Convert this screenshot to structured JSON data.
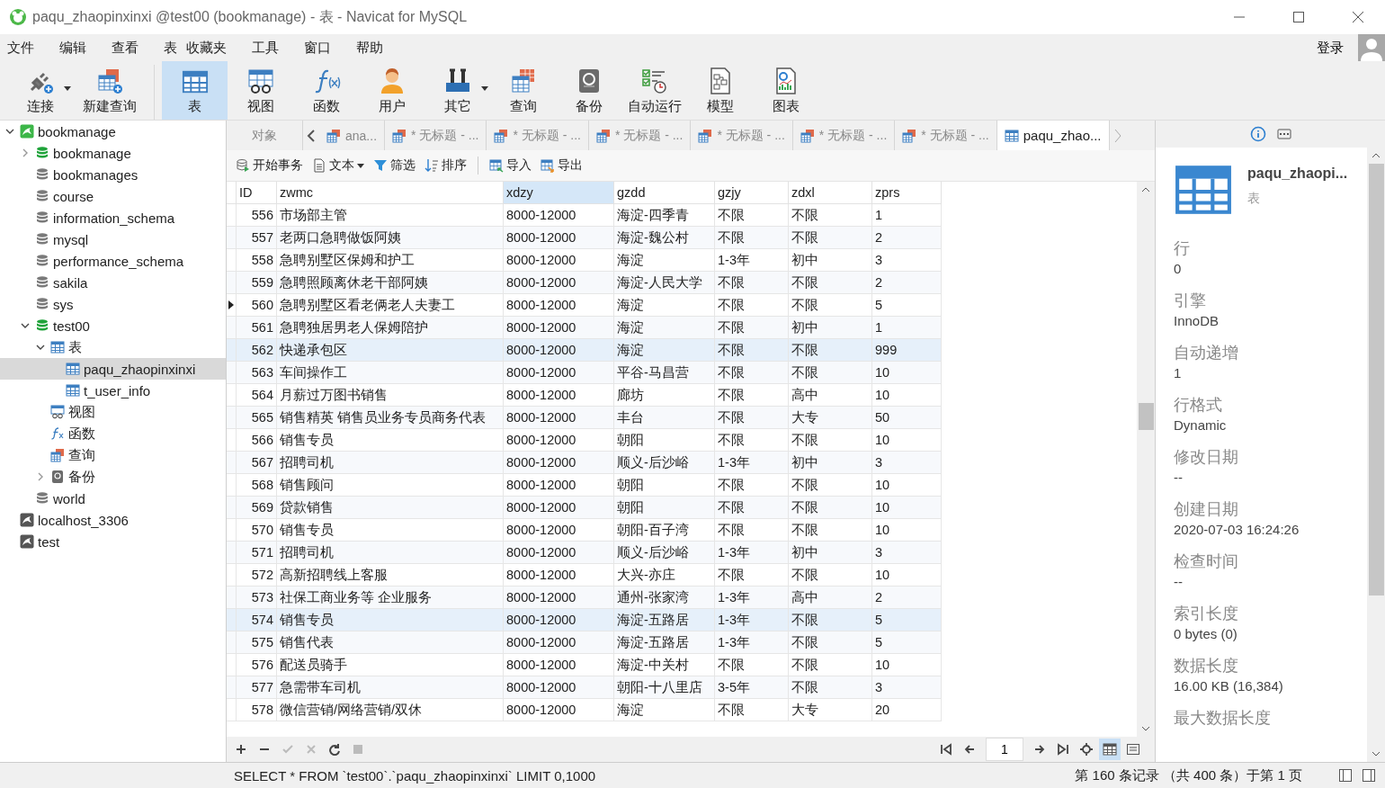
{
  "window": {
    "title": "paqu_zhaopinxinxi @test00 (bookmanage) - 表 - Navicat for MySQL"
  },
  "menu": [
    "文件",
    "编辑",
    "查看",
    "表",
    "收藏夹",
    "工具",
    "窗口",
    "帮助"
  ],
  "login": "登录",
  "toolbar": [
    {
      "label": "连接",
      "kind": "connect",
      "selected": false,
      "dropdown": true
    },
    {
      "label": "新建查询",
      "kind": "new-query",
      "selected": false,
      "dropdown": false
    },
    {
      "label": "表",
      "kind": "table",
      "selected": true,
      "dropdown": false
    },
    {
      "label": "视图",
      "kind": "view",
      "selected": false,
      "dropdown": false
    },
    {
      "label": "函数",
      "kind": "function",
      "selected": false,
      "dropdown": false
    },
    {
      "label": "用户",
      "kind": "user",
      "selected": false,
      "dropdown": false
    },
    {
      "label": "其它",
      "kind": "tools",
      "selected": false,
      "dropdown": true
    },
    {
      "label": "查询",
      "kind": "query",
      "selected": false,
      "dropdown": false
    },
    {
      "label": "备份",
      "kind": "backup",
      "selected": false,
      "dropdown": false
    },
    {
      "label": "自动运行",
      "kind": "schedule",
      "selected": false,
      "dropdown": false
    },
    {
      "label": "模型",
      "kind": "model",
      "selected": false,
      "dropdown": false
    },
    {
      "label": "图表",
      "kind": "chart",
      "selected": false,
      "dropdown": false
    }
  ],
  "tree": [
    {
      "label": "bookmanage",
      "kind": "connection",
      "open": true,
      "expanded": true,
      "selected": false,
      "children": [
        {
          "label": "bookmanage",
          "kind": "database",
          "open": true,
          "expanded": false,
          "selected": false
        },
        {
          "label": "bookmanages",
          "kind": "database",
          "open": false,
          "selected": false
        },
        {
          "label": "course",
          "kind": "database",
          "open": false,
          "selected": false
        },
        {
          "label": "information_schema",
          "kind": "database",
          "open": false,
          "selected": false
        },
        {
          "label": "mysql",
          "kind": "database",
          "open": false,
          "selected": false
        },
        {
          "label": "performance_schema",
          "kind": "database",
          "open": false,
          "selected": false
        },
        {
          "label": "sakila",
          "kind": "database",
          "open": false,
          "selected": false
        },
        {
          "label": "sys",
          "kind": "database",
          "open": false,
          "selected": false
        },
        {
          "label": "test00",
          "kind": "database",
          "open": true,
          "expanded": true,
          "selected": false,
          "children": [
            {
              "label": "表",
              "kind": "tables",
              "expanded": true,
              "selected": false,
              "children": [
                {
                  "label": "paqu_zhaopinxinxi",
                  "kind": "table",
                  "selected": true
                },
                {
                  "label": "t_user_info",
                  "kind": "table",
                  "selected": false
                }
              ]
            },
            {
              "label": "视图",
              "kind": "views",
              "selected": false
            },
            {
              "label": "函数",
              "kind": "functions",
              "selected": false
            },
            {
              "label": "查询",
              "kind": "queries",
              "selected": false
            },
            {
              "label": "备份",
              "kind": "backups",
              "expanded": false,
              "selected": false
            }
          ]
        },
        {
          "label": "world",
          "kind": "database",
          "open": false,
          "selected": false
        }
      ]
    },
    {
      "label": "localhost_3306",
      "kind": "connection",
      "open": false,
      "selected": false
    },
    {
      "label": "test",
      "kind": "connection",
      "open": false,
      "selected": false
    }
  ],
  "tabs": [
    {
      "label": "对象",
      "kind": "objects",
      "selected": false
    },
    {
      "label": "ana...",
      "kind": "query",
      "selected": false
    },
    {
      "label": "* 无标题 - ...",
      "kind": "query",
      "selected": false
    },
    {
      "label": "* 无标题 - ...",
      "kind": "query",
      "selected": false
    },
    {
      "label": "* 无标题 - ...",
      "kind": "query",
      "selected": false
    },
    {
      "label": "* 无标题 - ...",
      "kind": "query",
      "selected": false
    },
    {
      "label": "* 无标题 - ...",
      "kind": "query",
      "selected": false
    },
    {
      "label": "* 无标题 - ...",
      "kind": "query",
      "selected": false
    },
    {
      "label": "paqu_zhao...",
      "kind": "table",
      "selected": true
    }
  ],
  "actions": [
    {
      "label": "开始事务",
      "kind": "transaction",
      "dropdown": false
    },
    {
      "label": "文本",
      "kind": "text",
      "dropdown": true
    },
    {
      "label": "筛选",
      "kind": "filter",
      "dropdown": false
    },
    {
      "label": "排序",
      "kind": "sort",
      "dropdown": false
    },
    {
      "label": "导入",
      "kind": "import",
      "dropdown": false
    },
    {
      "label": "导出",
      "kind": "export",
      "dropdown": false
    }
  ],
  "table": {
    "columns": [
      {
        "label": "ID",
        "selected": false
      },
      {
        "label": "zwmc",
        "selected": false
      },
      {
        "label": "xdzy",
        "selected": true
      },
      {
        "label": "gzdd",
        "selected": false
      },
      {
        "label": "gzjy",
        "selected": false
      },
      {
        "label": "zdxl",
        "selected": false
      },
      {
        "label": "zprs",
        "selected": false
      }
    ],
    "rows": [
      {
        "cells": [
          "556",
          "市场部主管",
          "8000-12000",
          "海淀-四季青",
          "不限",
          "不限",
          "1"
        ],
        "current": false,
        "highlighted": false
      },
      {
        "cells": [
          "557",
          "老两口急聘做饭阿姨",
          "8000-12000",
          "海淀-魏公村",
          "不限",
          "不限",
          "2"
        ],
        "current": false,
        "highlighted": false
      },
      {
        "cells": [
          "558",
          "急聘别墅区保姆和护工",
          "8000-12000",
          "海淀",
          "1-3年",
          "初中",
          "3"
        ],
        "current": false,
        "highlighted": false
      },
      {
        "cells": [
          "559",
          "急聘照顾离休老干部阿姨",
          "8000-12000",
          "海淀-人民大学",
          "不限",
          "不限",
          "2"
        ],
        "current": false,
        "highlighted": false
      },
      {
        "cells": [
          "560",
          "急聘别墅区看老俩老人夫妻工",
          "8000-12000",
          "海淀",
          "不限",
          "不限",
          "5"
        ],
        "current": true,
        "highlighted": false
      },
      {
        "cells": [
          "561",
          "急聘独居男老人保姆陪护",
          "8000-12000",
          "海淀",
          "不限",
          "初中",
          "1"
        ],
        "current": false,
        "highlighted": false
      },
      {
        "cells": [
          "562",
          "快递承包区",
          "8000-12000",
          "海淀",
          "不限",
          "不限",
          "999"
        ],
        "current": false,
        "highlighted": true
      },
      {
        "cells": [
          "563",
          "车间操作工",
          "8000-12000",
          "平谷-马昌营",
          "不限",
          "不限",
          "10"
        ],
        "current": false,
        "highlighted": false
      },
      {
        "cells": [
          "564",
          "月薪过万图书销售",
          "8000-12000",
          "廊坊",
          "不限",
          "高中",
          "10"
        ],
        "current": false,
        "highlighted": false
      },
      {
        "cells": [
          "565",
          "销售精英 销售员业务专员商务代表",
          "8000-12000",
          "丰台",
          "不限",
          "大专",
          "50"
        ],
        "current": false,
        "highlighted": false
      },
      {
        "cells": [
          "566",
          "销售专员",
          "8000-12000",
          "朝阳",
          "不限",
          "不限",
          "10"
        ],
        "current": false,
        "highlighted": false
      },
      {
        "cells": [
          "567",
          "招聘司机",
          "8000-12000",
          "顺义-后沙峪",
          "1-3年",
          "初中",
          "3"
        ],
        "current": false,
        "highlighted": false
      },
      {
        "cells": [
          "568",
          "销售顾问",
          "8000-12000",
          "朝阳",
          "不限",
          "不限",
          "10"
        ],
        "current": false,
        "highlighted": false
      },
      {
        "cells": [
          "569",
          "贷款销售",
          "8000-12000",
          "朝阳",
          "不限",
          "不限",
          "10"
        ],
        "current": false,
        "highlighted": false
      },
      {
        "cells": [
          "570",
          "销售专员",
          "8000-12000",
          "朝阳-百子湾",
          "不限",
          "不限",
          "10"
        ],
        "current": false,
        "highlighted": false
      },
      {
        "cells": [
          "571",
          "招聘司机",
          "8000-12000",
          "顺义-后沙峪",
          "1-3年",
          "初中",
          "3"
        ],
        "current": false,
        "highlighted": false
      },
      {
        "cells": [
          "572",
          "高新招聘线上客服",
          "8000-12000",
          "大兴-亦庄",
          "不限",
          "不限",
          "10"
        ],
        "current": false,
        "highlighted": false
      },
      {
        "cells": [
          "573",
          "社保工商业务等 企业服务",
          "8000-12000",
          "通州-张家湾",
          "1-3年",
          "高中",
          "2"
        ],
        "current": false,
        "highlighted": false
      },
      {
        "cells": [
          "574",
          "销售专员",
          "8000-12000",
          "海淀-五路居",
          "1-3年",
          "不限",
          "5"
        ],
        "current": false,
        "highlighted": true
      },
      {
        "cells": [
          "575",
          "销售代表",
          "8000-12000",
          "海淀-五路居",
          "1-3年",
          "不限",
          "5"
        ],
        "current": false,
        "highlighted": false
      },
      {
        "cells": [
          "576",
          "配送员骑手",
          "8000-12000",
          "海淀-中关村",
          "不限",
          "不限",
          "10"
        ],
        "current": false,
        "highlighted": false
      },
      {
        "cells": [
          "577",
          "急需带车司机",
          "8000-12000",
          "朝阳-十八里店",
          "3-5年",
          "不限",
          "3"
        ],
        "current": false,
        "highlighted": false
      },
      {
        "cells": [
          "578",
          "微信营销/网络营销/双休",
          "8000-12000",
          "海淀",
          "不限",
          "大专",
          "20"
        ],
        "current": false,
        "highlighted": false
      }
    ]
  },
  "pager": {
    "page": "1",
    "views": [
      {
        "kind": "grid",
        "selected": true
      },
      {
        "kind": "form",
        "selected": false
      }
    ]
  },
  "info": {
    "name": "paqu_zhaopi...",
    "type": "表",
    "properties": [
      {
        "label": "行",
        "value": "0"
      },
      {
        "label": "引擎",
        "value": "InnoDB"
      },
      {
        "label": "自动递增",
        "value": "1"
      },
      {
        "label": "行格式",
        "value": "Dynamic"
      },
      {
        "label": "修改日期",
        "value": "--"
      },
      {
        "label": "创建日期",
        "value": "2020-07-03 16:24:26"
      },
      {
        "label": "检查时间",
        "value": "--"
      },
      {
        "label": "索引长度",
        "value": "0 bytes (0)"
      },
      {
        "label": "数据长度",
        "value": "16.00 KB (16,384)"
      },
      {
        "label": "最大数据长度"
      }
    ]
  },
  "status": {
    "sql": "SELECT * FROM `test00`.`paqu_zhaopinxinxi` LIMIT 0,1000",
    "records": "第 160 条记录 （共 400 条）于第 1 页"
  }
}
